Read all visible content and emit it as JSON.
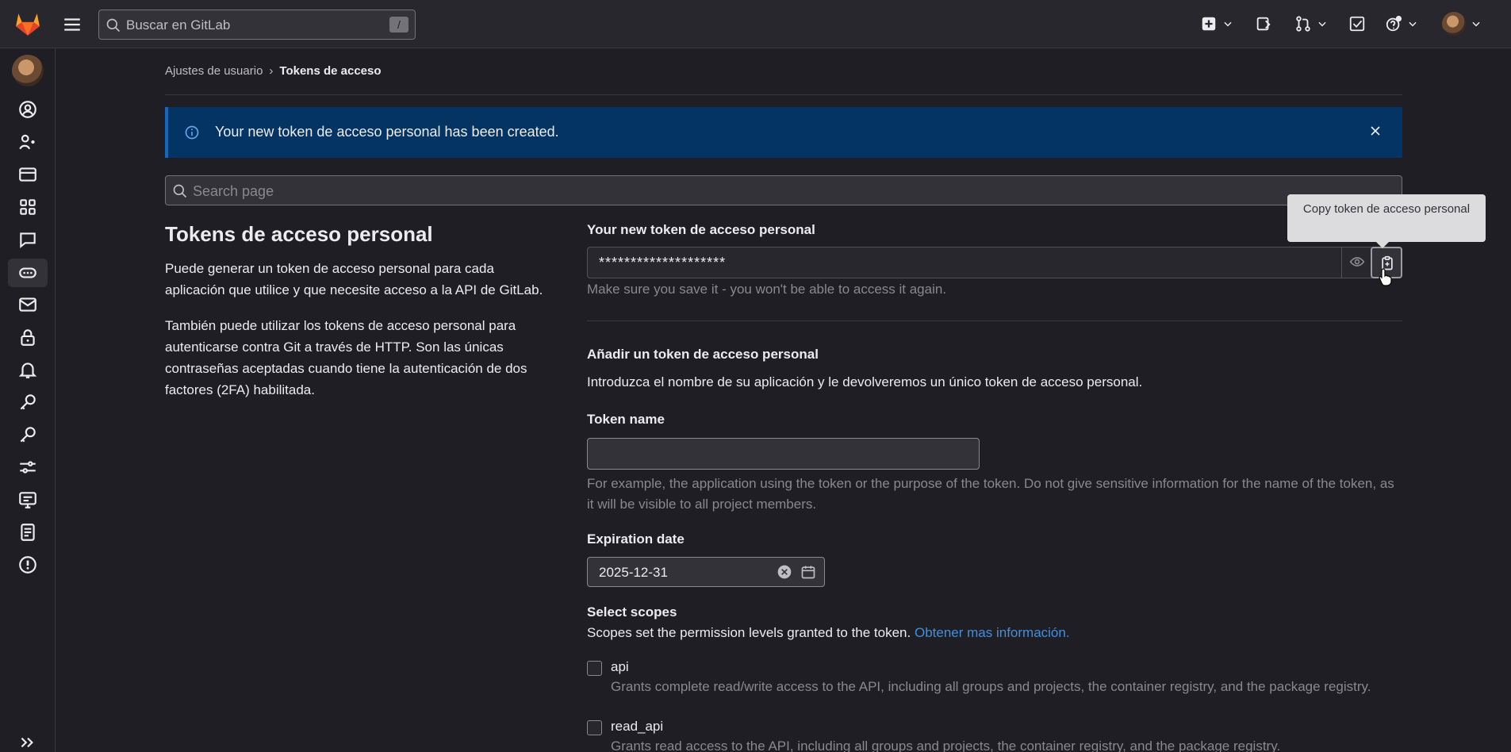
{
  "topbar": {
    "search_placeholder": "Buscar en GitLab",
    "search_shortcut": "/"
  },
  "breadcrumb": {
    "parent": "Ajustes de usuario",
    "current": "Tokens de acceso"
  },
  "alert": {
    "message": "Your new token de acceso personal has been created."
  },
  "page_search": {
    "placeholder": "Search page"
  },
  "intro": {
    "title": "Tokens de acceso personal",
    "para1": "Puede generar un token de acceso personal para cada aplicación que utilice y que necesite acceso a la API de GitLab.",
    "para2": "También puede utilizar los tokens de acceso personal para autenticarse contra Git a través de HTTP. Son las únicas contraseñas aceptadas cuando tiene la autenticación de dos factores (2FA) habilitada."
  },
  "new_token": {
    "label": "Your new token de acceso personal",
    "masked_value": "********************",
    "help": "Make sure you save it - you won't be able to access it again.",
    "tooltip": "Copy token de acceso personal"
  },
  "add_token": {
    "title": "Añadir un token de acceso personal",
    "description": "Introduzca el nombre de su aplicación y le devolveremos un único token de acceso personal.",
    "name_label": "Token name",
    "name_value": "",
    "name_help": "For example, the application using the token or the purpose of the token. Do not give sensitive information for the name of the token, as it will be visible to all project members.",
    "expiration_label": "Expiration date",
    "expiration_value": "2025-12-31",
    "scopes_title": "Select scopes",
    "scopes_desc": "Scopes set the permission levels granted to the token.",
    "scopes_link": "Obtener mas información.",
    "scopes": [
      {
        "name": "api",
        "desc": "Grants complete read/write access to the API, including all groups and projects, the container registry, and the package registry."
      },
      {
        "name": "read_api",
        "desc": "Grants read access to the API, including all groups and projects, the container registry, and the package registry."
      }
    ]
  },
  "colors": {
    "background": "#1f1e24",
    "alert_bg": "#033464",
    "link": "#428fdc"
  }
}
